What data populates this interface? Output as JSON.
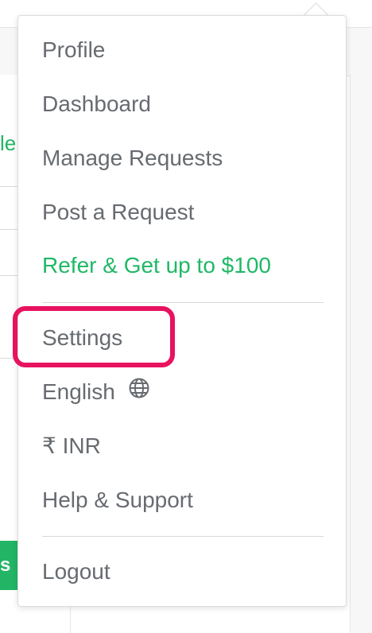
{
  "background": {
    "partial_link_text": "le",
    "partial_button_text": "s"
  },
  "menu": {
    "profile": "Profile",
    "dashboard": "Dashboard",
    "manage_requests": "Manage Requests",
    "post_request": "Post a Request",
    "refer": "Refer & Get up to $100",
    "settings": "Settings",
    "language": "English",
    "currency": "₹ INR",
    "help": "Help & Support",
    "logout": "Logout"
  },
  "colors": {
    "accent_green": "#1fb866",
    "highlight": "#e8125f",
    "text_gray": "#676b70"
  },
  "icons": {
    "language": "globe-icon"
  }
}
